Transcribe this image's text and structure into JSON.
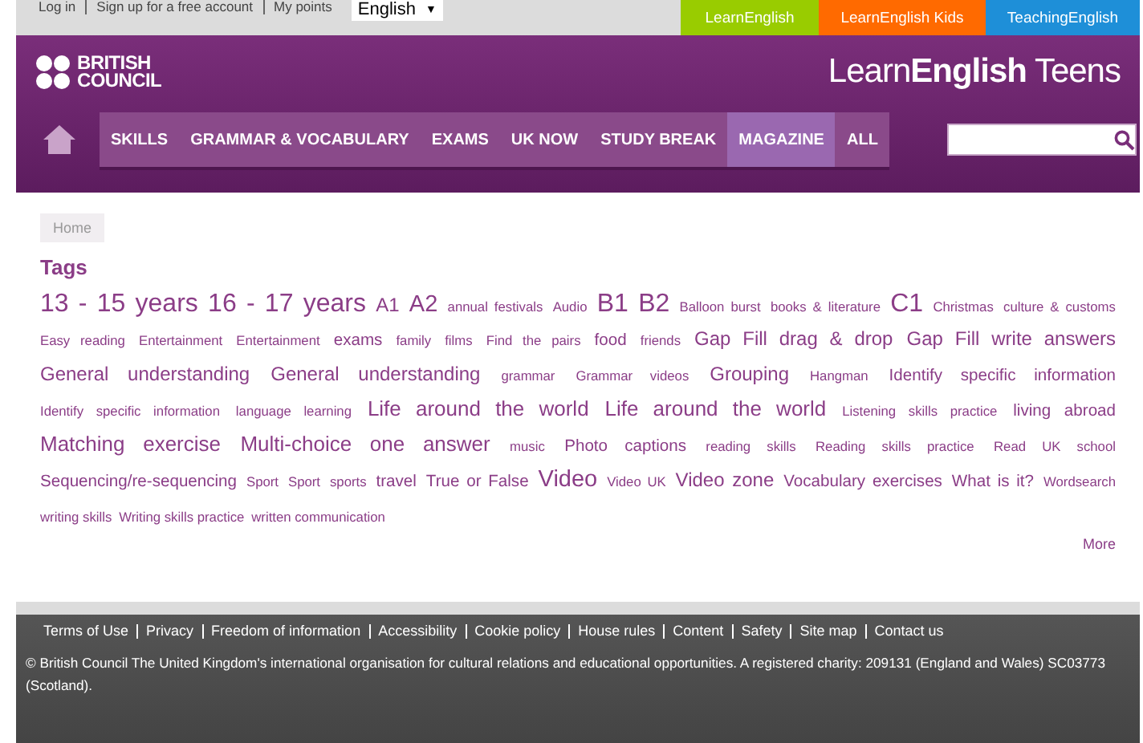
{
  "top_bar": {
    "links": [
      "Log in",
      "Sign up for a free account",
      "My points"
    ],
    "language": "English",
    "language_arrow": "▼",
    "sites": [
      {
        "label": "LearnEnglish",
        "color": "#99cc00"
      },
      {
        "label": "LearnEnglish Kids",
        "color": "#ff6a00"
      },
      {
        "label": "TeachingEnglish",
        "color": "#1e8fd8"
      }
    ]
  },
  "header": {
    "logo_lines": [
      "BRITISH",
      "COUNCIL"
    ],
    "site_title_light": "Learn",
    "site_title_bold": "English",
    "site_title_rest": "Teens"
  },
  "nav": [
    {
      "label": "SKILLS",
      "selected": false
    },
    {
      "label": "GRAMMAR & VOCABULARY",
      "selected": false
    },
    {
      "label": "EXAMS",
      "selected": false
    },
    {
      "label": "UK NOW",
      "selected": false
    },
    {
      "label": "STUDY BREAK",
      "selected": false
    },
    {
      "label": "MAGAZINE",
      "selected": true
    },
    {
      "label": "ALL",
      "selected": false
    }
  ],
  "breadcrumb": "Home",
  "heading": "Tags",
  "tags": [
    {
      "label": "13 - 15 years",
      "kind": "xl"
    },
    {
      "label": "16 - 17 years",
      "kind": "xl"
    },
    {
      "label": "A1",
      "kind": "m"
    },
    {
      "label": "A2",
      "kind": "l"
    },
    {
      "label": "annual festivals",
      "kind": "xs"
    },
    {
      "label": "Audio",
      "kind": "xs"
    },
    {
      "label": "B1",
      "kind": "xl"
    },
    {
      "label": "B2",
      "kind": "xl"
    },
    {
      "label": "Balloon burst",
      "kind": "xs"
    },
    {
      "label": "books & literature",
      "kind": "xs"
    },
    {
      "label": "C1",
      "kind": "xl"
    },
    {
      "label": "Christmas",
      "kind": "xs"
    },
    {
      "label": "culture & customs",
      "kind": "xs"
    },
    {
      "label": "Easy reading",
      "kind": "xs"
    },
    {
      "label": "Entertainment",
      "kind": "xs"
    },
    {
      "label": "Entertainment",
      "kind": "xs"
    },
    {
      "label": "exams",
      "kind": "s"
    },
    {
      "label": "family",
      "kind": "xs"
    },
    {
      "label": "films",
      "kind": "xs"
    },
    {
      "label": "Find the pairs",
      "kind": "xs"
    },
    {
      "label": "food",
      "kind": "s"
    },
    {
      "label": "friends",
      "kind": "xs"
    },
    {
      "label": "Gap Fill drag & drop",
      "kind": "m"
    },
    {
      "label": "Gap Fill write answers",
      "kind": "m"
    },
    {
      "label": "General understanding",
      "kind": "m"
    },
    {
      "label": "General understanding",
      "kind": "m"
    },
    {
      "label": "grammar",
      "kind": "xs"
    },
    {
      "label": "Grammar videos",
      "kind": "xs"
    },
    {
      "label": "Grouping",
      "kind": "m"
    },
    {
      "label": "Hangman",
      "kind": "xs"
    },
    {
      "label": "Identify specific information",
      "kind": "s"
    },
    {
      "label": "Identify specific information",
      "kind": "xs"
    },
    {
      "label": "language learning",
      "kind": "xs"
    },
    {
      "label": "Life around the world",
      "kind": "ml"
    },
    {
      "label": "Life around the world",
      "kind": "ml"
    },
    {
      "label": "Listening skills practice",
      "kind": "xs"
    },
    {
      "label": "living abroad",
      "kind": "s"
    },
    {
      "label": "Matching exercise",
      "kind": "ml"
    },
    {
      "label": "Multi-choice one answer",
      "kind": "ml"
    },
    {
      "label": "music",
      "kind": "xs"
    },
    {
      "label": "Photo captions",
      "kind": "s"
    },
    {
      "label": "reading skills",
      "kind": "xs"
    },
    {
      "label": "Reading skills practice",
      "kind": "xs"
    },
    {
      "label": "Read UK school",
      "kind": "xs"
    },
    {
      "label": "Sequencing/re-sequencing",
      "kind": "s"
    },
    {
      "label": "Sport",
      "kind": "xs"
    },
    {
      "label": "Sport",
      "kind": "xs"
    },
    {
      "label": "sports",
      "kind": "xs"
    },
    {
      "label": "travel",
      "kind": "s"
    },
    {
      "label": "True or False",
      "kind": "s"
    },
    {
      "label": "Video",
      "kind": "l"
    },
    {
      "label": "Video UK",
      "kind": "xs"
    },
    {
      "label": "Video zone",
      "kind": "m"
    },
    {
      "label": "Vocabulary exercises",
      "kind": "s"
    },
    {
      "label": "What is it?",
      "kind": "s"
    },
    {
      "label": "Wordsearch",
      "kind": "xs"
    },
    {
      "label": "writing skills",
      "kind": "xs"
    },
    {
      "label": "Writing skills practice",
      "kind": "xs"
    },
    {
      "label": "written communication",
      "kind": "xs"
    }
  ],
  "more": "More",
  "footer": {
    "links": [
      "Terms of Use",
      "Privacy",
      "Freedom of information",
      "Accessibility",
      "Cookie policy",
      "House rules",
      "Content",
      "Safety",
      "Site map",
      "Contact us"
    ],
    "notice": "© British Council The United Kingdom's international organisation for cultural relations and educational opportunities. A registered charity: 209131 (England and Wales) SC03773",
    "notice_end": "(Scotland)."
  }
}
